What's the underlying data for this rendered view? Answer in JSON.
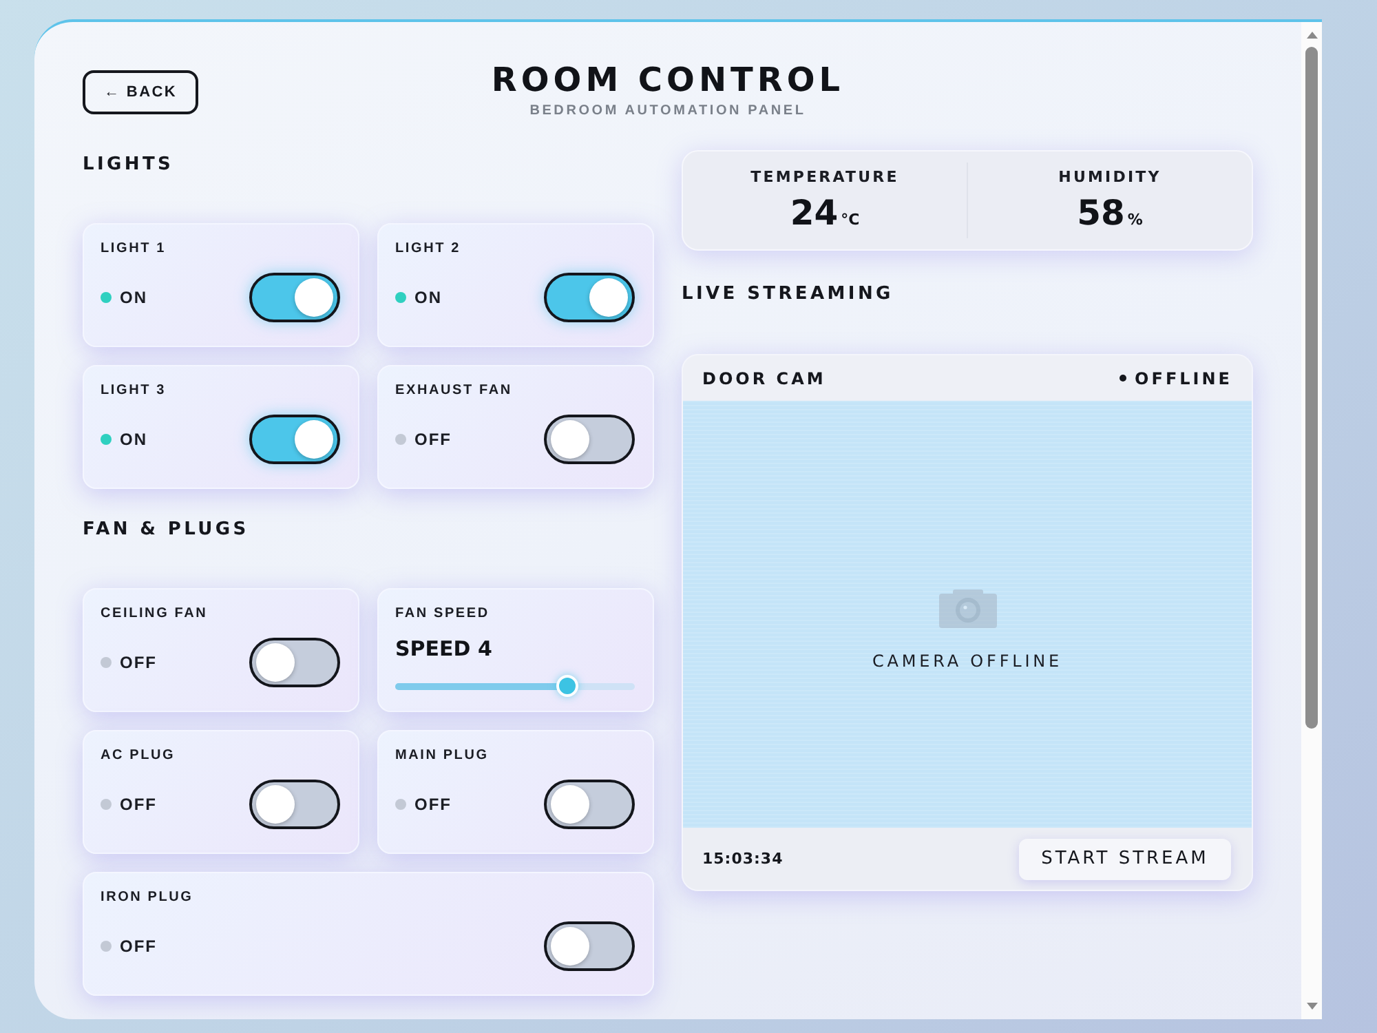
{
  "back_button": {
    "label": "← BACK"
  },
  "header": {
    "title": "ROOM CONTROL",
    "subtitle": "BEDROOM AUTOMATION PANEL"
  },
  "sections": [
    {
      "title": "LIGHTS",
      "devices": [
        {
          "kind": "switch",
          "name": "LIGHT 1",
          "status": "ON",
          "on": true
        },
        {
          "kind": "switch",
          "name": "LIGHT 2",
          "status": "ON",
          "on": true
        },
        {
          "kind": "switch",
          "name": "LIGHT 3",
          "status": "ON",
          "on": true
        },
        {
          "kind": "switch",
          "name": "EXHAUST FAN",
          "status": "OFF",
          "on": false
        }
      ]
    },
    {
      "title": "FAN & PLUGS",
      "devices": [
        {
          "kind": "switch",
          "name": "CEILING FAN",
          "status": "OFF",
          "on": false
        },
        {
          "kind": "slider",
          "name": "FAN SPEED",
          "value": "SPEED 4",
          "level": 0.72
        },
        {
          "kind": "switch",
          "name": "AC PLUG",
          "status": "OFF",
          "on": false
        },
        {
          "kind": "switch",
          "name": "MAIN PLUG",
          "status": "OFF",
          "on": false
        },
        {
          "kind": "switch",
          "name": "IRON PLUG",
          "status": "OFF",
          "on": false
        }
      ]
    }
  ],
  "sensors": [
    {
      "label": "TEMPERATURE",
      "value": "24",
      "unit": "°C"
    },
    {
      "label": "HUMIDITY",
      "value": "58",
      "unit": "%"
    }
  ],
  "live_streaming": {
    "title": "LIVE STREAMING",
    "camera": {
      "name": "DOOR CAM",
      "status": "OFFLINE",
      "online": false,
      "message": "CAMERA OFFLINE",
      "time": "15:03:34",
      "button": "START STREAM"
    }
  }
}
